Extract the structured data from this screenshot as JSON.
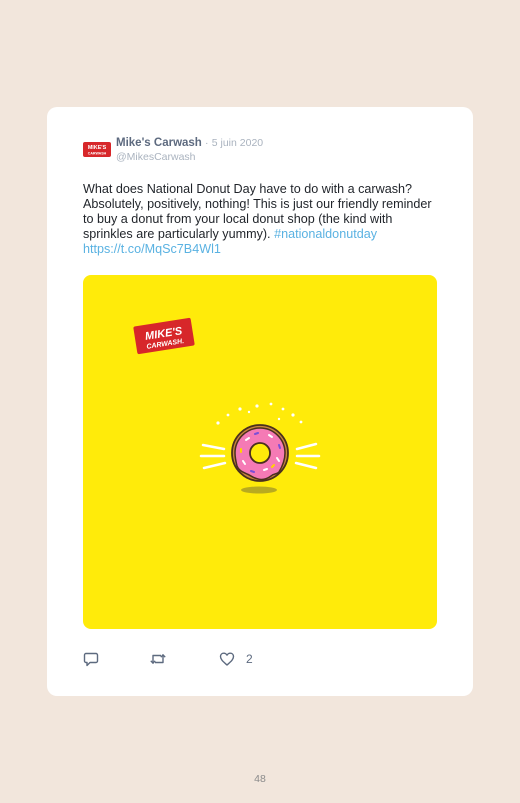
{
  "tweet": {
    "author_name": "Mike's Carwash",
    "separator": "·",
    "date": "5 juin 2020",
    "handle": "@MikesCarwash",
    "text": "What does National Donut Day have to do with a carwash? Absolutely, positively, nothing! This is just our friendly reminder to buy a donut from your local donut shop (the kind with sprinkles are particularly yummy).",
    "hashtag": "#nationaldonutday",
    "link": "https://t.co/MqSc7B4Wl1",
    "avatar_logo_text": [
      "MIKE'S",
      "CARWASH"
    ],
    "media": {
      "logo_text": [
        "MIKE'S",
        "CARWASH."
      ],
      "background_color": "#ffeb0a",
      "illustration": "pink-frosted-donut-with-sprinkles"
    },
    "actions": {
      "reply_icon": "reply-icon",
      "retweet_icon": "retweet-icon",
      "like_icon": "heart-icon",
      "like_count": "2"
    }
  },
  "colors": {
    "page_background": "#f2e6dc",
    "card_background": "#ffffff",
    "link": "#5ab2e2",
    "brand_red": "#d7272a"
  },
  "page_number": "48"
}
